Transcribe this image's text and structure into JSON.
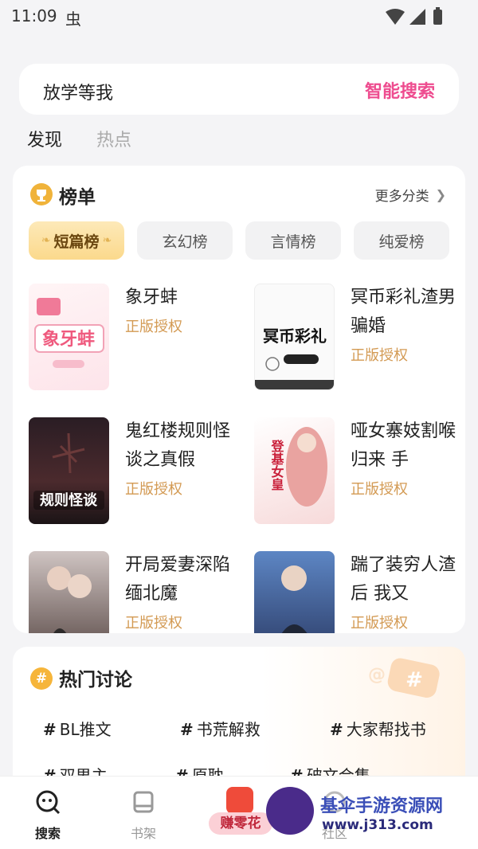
{
  "status_bar": {
    "time": "11:09",
    "bug_glyph": "虫"
  },
  "search": {
    "query": "放学等我",
    "action_label": "智能搜索"
  },
  "tabs": [
    {
      "label": "发现"
    },
    {
      "label": "热点"
    }
  ],
  "rankings": {
    "title": "榜单",
    "more_label": "更多分类",
    "chips": [
      {
        "label": "短篇榜"
      },
      {
        "label": "玄幻榜"
      },
      {
        "label": "言情榜"
      },
      {
        "label": "纯爱榜"
      }
    ],
    "books": [
      {
        "title": "象牙蚌",
        "tag": "正版授权",
        "cover_text": "象牙蚌"
      },
      {
        "title": "冥币彩礼渣男骗婚",
        "tag": "正版授权",
        "cover_text": "冥币彩礼"
      },
      {
        "title": "鬼红楼规则怪谈之真假",
        "tag": "正版授权",
        "cover_text": "规则怪谈"
      },
      {
        "title": "哑女寨妓割喉归来 手",
        "tag": "正版授权",
        "cover_text": "登基女皇"
      },
      {
        "title": "开局爱妻深陷缅北魔",
        "tag": "正版授权"
      },
      {
        "title": "踹了装穷人渣后 我又",
        "tag": "正版授权"
      }
    ]
  },
  "discussions": {
    "title": "热门讨论",
    "topics": [
      {
        "label": "BL推文"
      },
      {
        "label": "书荒解救"
      },
      {
        "label": "大家帮找书"
      },
      {
        "label": "双男主"
      },
      {
        "label": "原耽"
      },
      {
        "label": "破文合集"
      }
    ]
  },
  "bottom_nav": {
    "items": [
      {
        "label": "搜索"
      },
      {
        "label": "书架"
      },
      {
        "label": "社区"
      }
    ],
    "promo_label": "赚零花"
  },
  "watermark": {
    "title": "基伞手游资源网",
    "url": "www.j313.com"
  },
  "colors": {
    "accent": "#ee4c8f",
    "tag": "#d39a53",
    "chip_active": "#fbd98c"
  }
}
